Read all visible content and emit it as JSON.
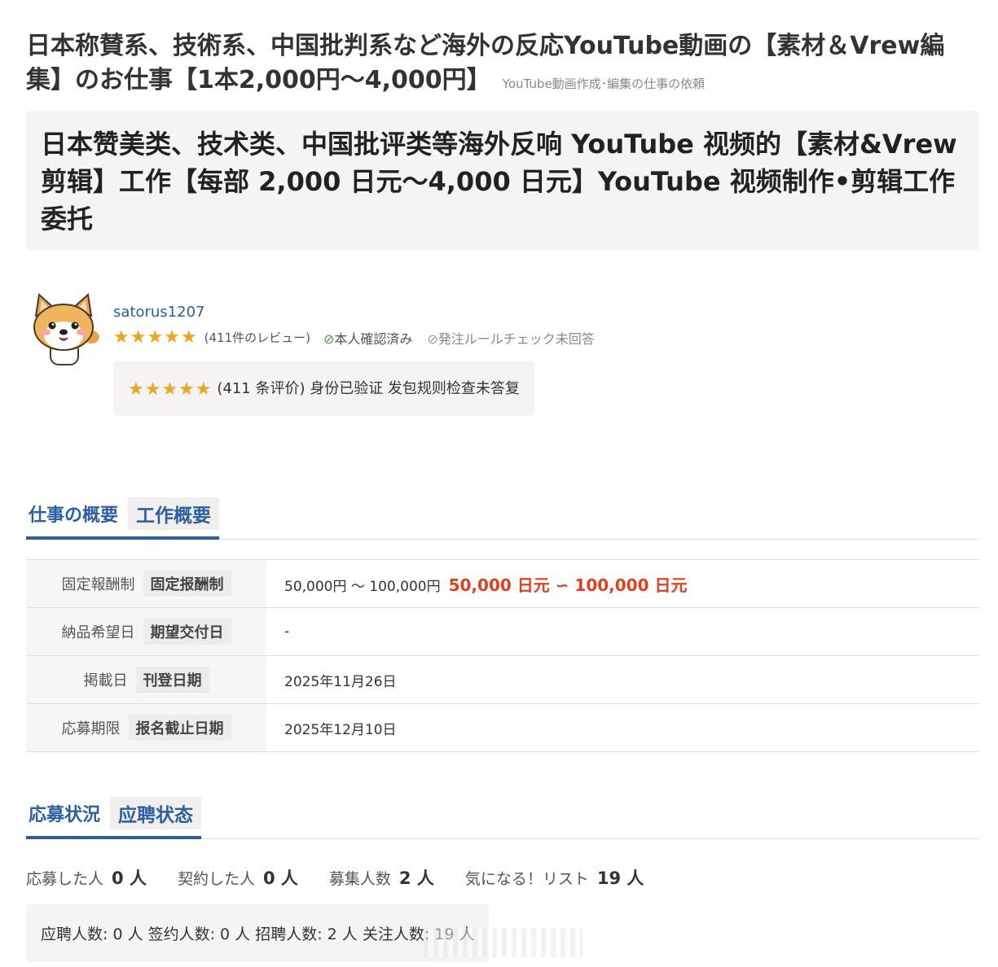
{
  "job": {
    "title": "日本称賛系、技術系、中国批判系など海外の反応YouTube動画の【素材＆Vrew編集】のお仕事【1本2,000円〜4,000円】",
    "category": "YouTube動画作成･編集の仕事の依頼",
    "title_translation": "日本赞美类、技术类、中国批评类等海外反响 YouTube 视频的【素材&Vrew 剪辑】工作【每部 2,000 日元～4,000 日元】YouTube 视频制作•剪辑工作委托"
  },
  "client": {
    "name": "satorus1207",
    "stars": "★★★★★",
    "rating": 5,
    "reviews": "(411件のレビュー)",
    "verified": "本人確認済み",
    "rule_check": "発注ルールチェック未回答",
    "translation_stars": "★★★★★",
    "translation": "(411 条评价) 身份已验证 发包规则检查未答复"
  },
  "overview": {
    "heading": "仕事の概要",
    "heading_cn": "工作概要",
    "rows": [
      {
        "label": "固定報酬制",
        "label_cn": "固定报酬制",
        "value": "50,000円 〜 100,000円",
        "value_cn": "50,000 日元 ∽ 100,000 日元"
      },
      {
        "label": "納品希望日",
        "label_cn": "期望交付日",
        "value": "-"
      },
      {
        "label": "掲載日",
        "label_cn": "刊登日期",
        "value": "2025年11月26日"
      },
      {
        "label": "応募期限",
        "label_cn": "报名截止日期",
        "value": "2025年12月10日"
      }
    ]
  },
  "application": {
    "heading": "応募状況",
    "heading_cn": "应聘状态",
    "items": [
      {
        "label": "応募した人",
        "value": "0 人"
      },
      {
        "label": "契約した人",
        "value": "0 人"
      },
      {
        "label": "募集人数",
        "value": "2 人"
      },
      {
        "label": "気になる！リスト",
        "value": "19 人"
      }
    ],
    "translation": "应聘人数: 0 人 签约人数: 0 人 招聘人数: 2 人 关注人数: 19 人"
  },
  "colors": {
    "accent": "#2b5fa0",
    "price": "#e0401f",
    "star": "#f0a31b",
    "check": "#43a047"
  }
}
